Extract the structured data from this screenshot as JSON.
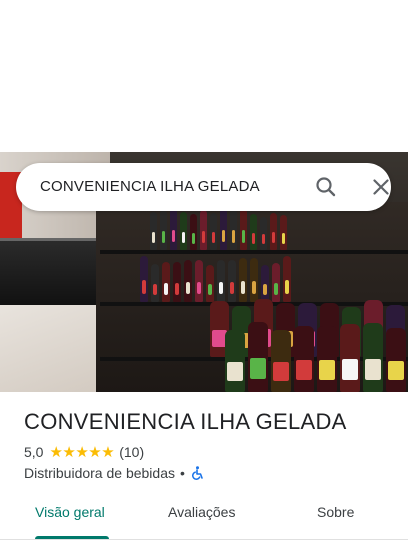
{
  "search": {
    "query": "CONVENIENCIA ILHA GELADA"
  },
  "place": {
    "name": "CONVENIENCIA ILHA GELADA",
    "rating": "5,0",
    "stars": "★★★★★",
    "review_count": "(10)",
    "category": "Distribuidora de bebidas",
    "separator": "•"
  },
  "tabs": [
    {
      "label": "Visão geral",
      "active": true
    },
    {
      "label": "Avaliações",
      "active": false
    },
    {
      "label": "Sobre",
      "active": false
    }
  ],
  "icons": {
    "search": "search-icon",
    "close": "close-icon",
    "accessibility": "wheelchair-icon"
  },
  "colors": {
    "accent": "#00796b",
    "star": "#fbbc04"
  }
}
